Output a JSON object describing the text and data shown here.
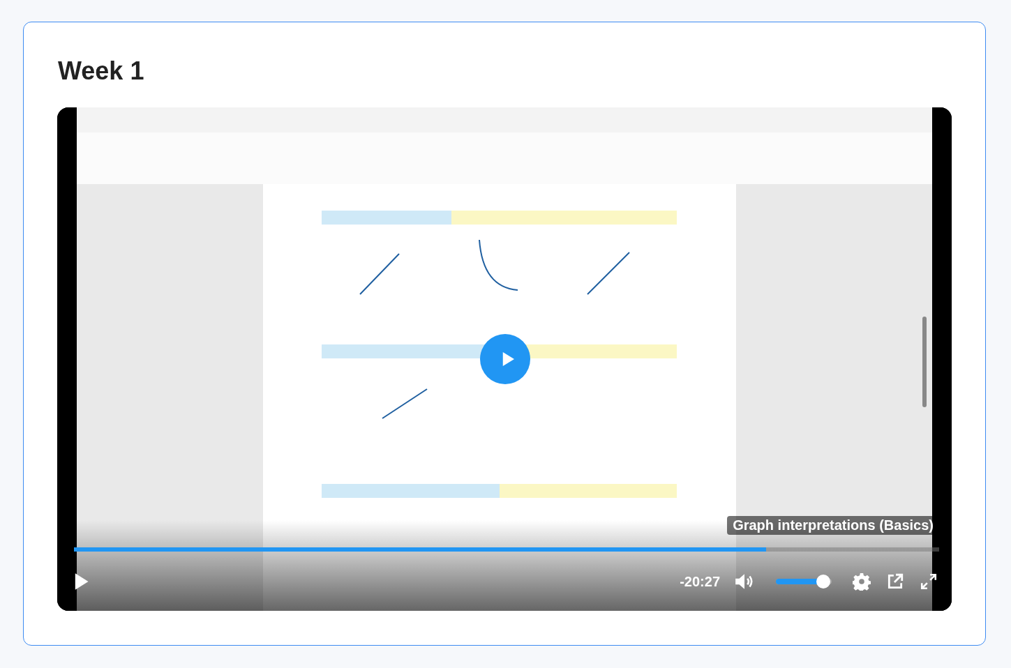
{
  "heading": "Week 1",
  "video": {
    "kind": "picture",
    "playing": false,
    "chapter_title": "Graph interpretations (Basics)",
    "progress": {
      "level": 0.8
    },
    "time_remaining": "-20:27",
    "volume": {
      "muted": false,
      "level": 0.85
    }
  }
}
